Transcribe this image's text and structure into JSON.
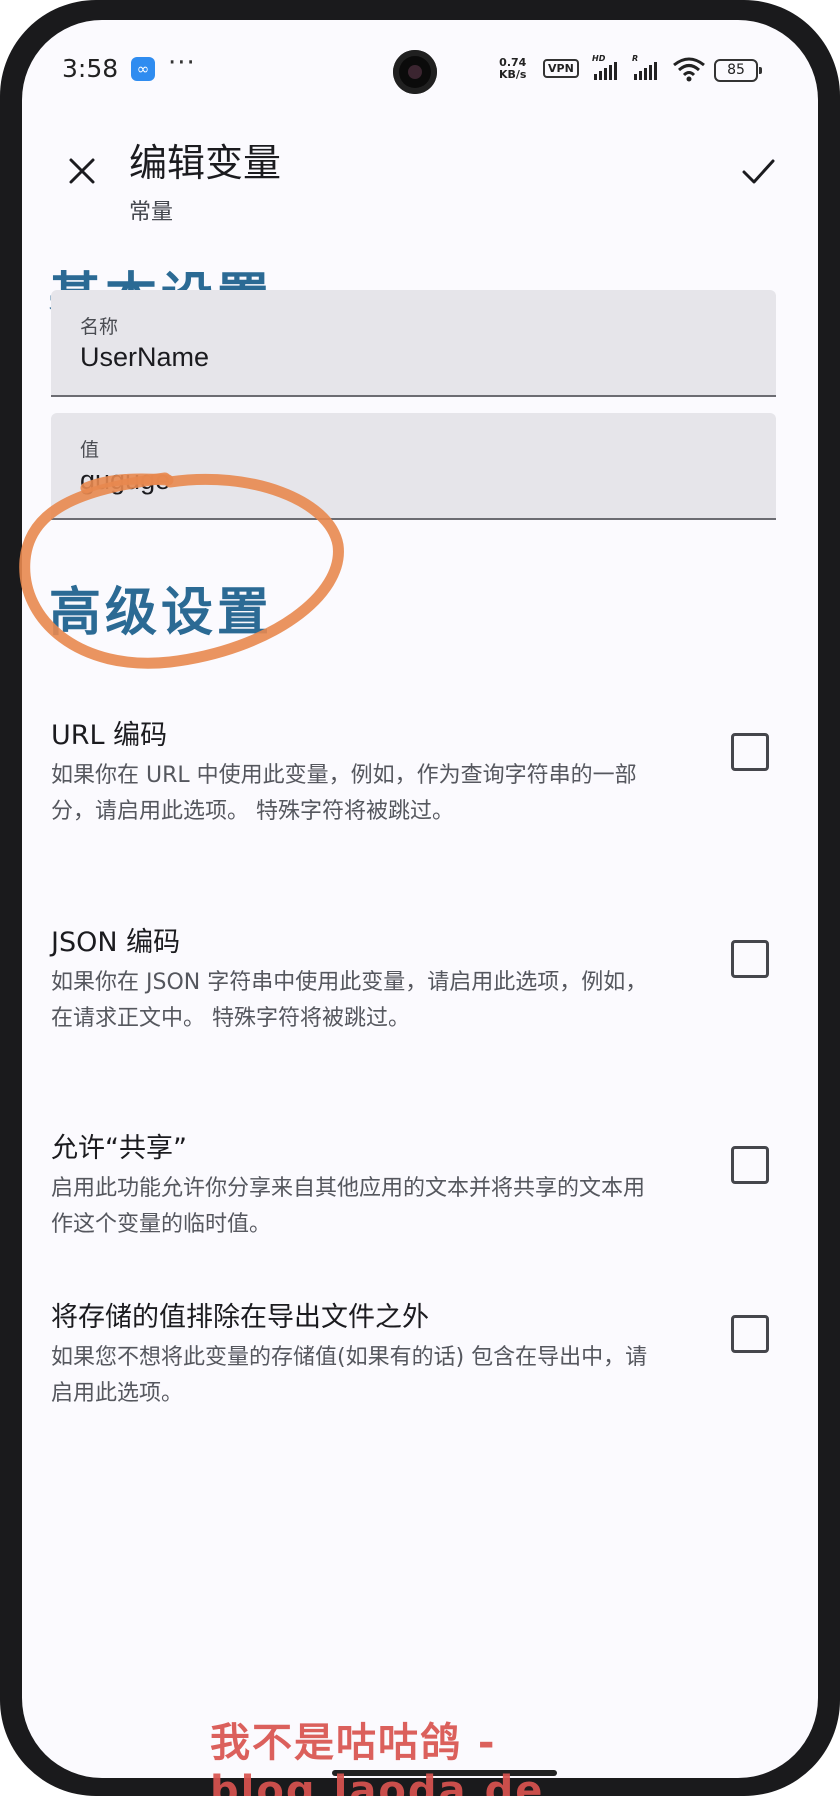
{
  "status_bar": {
    "time": "3:58",
    "more": "···",
    "net_speed_value": "0.74",
    "net_speed_unit": "KB/s",
    "vpn": "VPN",
    "hd_label": "HD",
    "r_label": "R",
    "battery": "85"
  },
  "header": {
    "title": "编辑变量",
    "subtitle": "常量"
  },
  "basic": {
    "section_title": "基本设置",
    "name_label": "名称",
    "name_value": "UserName",
    "value_label": "值",
    "value_value": "guguge"
  },
  "advanced": {
    "section_title": "高级设置",
    "options": [
      {
        "title": "URL 编码",
        "desc": "如果你在 URL 中使用此变量，例如，作为查询字符串的一部分，请启用此选项。 特殊字符将被跳过。",
        "checked": false
      },
      {
        "title": "JSON 编码",
        "desc": "如果你在 JSON 字符串中使用此变量，请启用此选项，例如，在请求正文中。 特殊字符将被跳过。",
        "checked": false
      },
      {
        "title": "允许“共享”",
        "desc": "启用此功能允许你分享来自其他应用的文本并将共享的文本用作这个变量的临时值。",
        "checked": false
      },
      {
        "title": "将存储的值排除在导出文件之外",
        "desc": "如果您不想将此变量的存储值(如果有的话) 包含在导出中，请启用此选项。",
        "checked": false
      }
    ]
  },
  "watermark": "我不是咕咕鸽 - blog.laoda.de",
  "colors": {
    "section_title": "#2b6a94",
    "annotation": "#e8884f",
    "watermark": "#d9534f"
  }
}
